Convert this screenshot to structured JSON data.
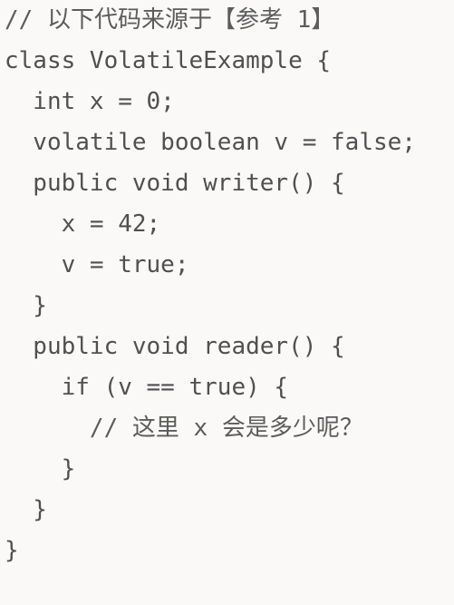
{
  "code": {
    "lines": [
      "// 以下代码来源于【参考 1】",
      "class VolatileExample {",
      "  int x = 0;",
      "  volatile boolean v = false;",
      "  public void writer() {",
      "    x = 42;",
      "    v = true;",
      "  }",
      "  public void reader() {",
      "    if (v == true) {",
      "      // 这里 x 会是多少呢？",
      "    }",
      "  }",
      "}"
    ]
  }
}
